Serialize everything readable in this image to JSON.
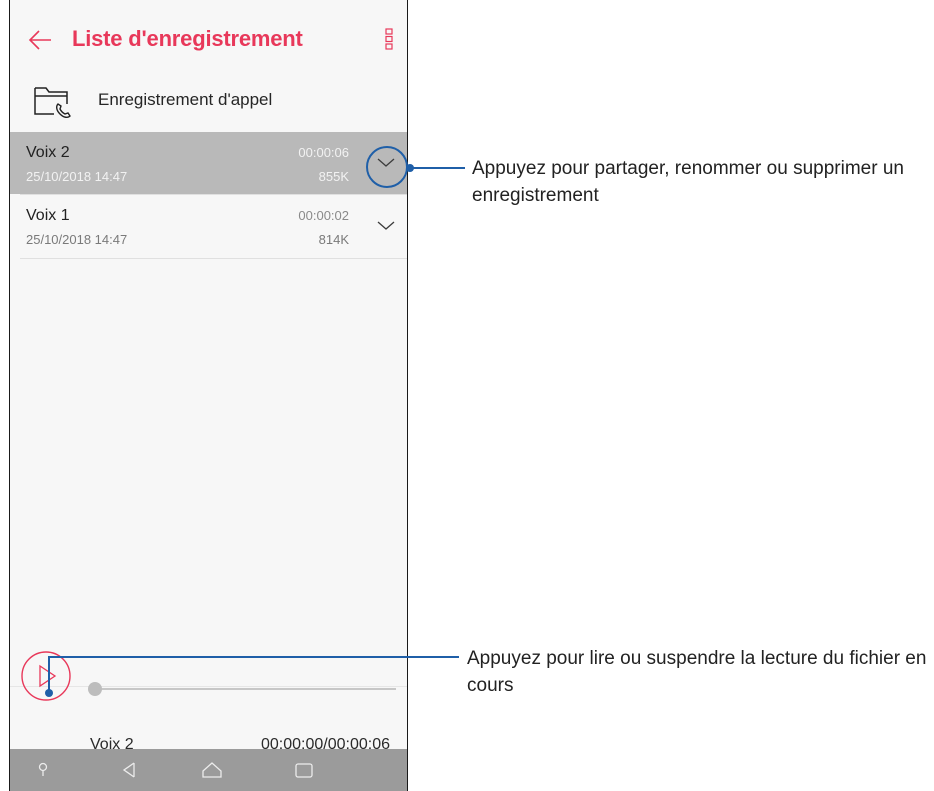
{
  "header": {
    "title": "Liste d'enregistrement",
    "back_icon": "arrow-left-icon",
    "menu_icon": "more-vert-icon"
  },
  "folder": {
    "label": "Enregistrement d'appel",
    "icon": "call-folder-icon"
  },
  "recordings": [
    {
      "name": "Voix 2",
      "date": "25/10/2018 14:47",
      "duration": "00:00:06",
      "size": "855K",
      "selected": true
    },
    {
      "name": "Voix 1",
      "date": "25/10/2018 14:47",
      "duration": "00:00:02",
      "size": "814K",
      "selected": false
    }
  ],
  "player": {
    "track_name": "Voix 2",
    "time": "00:00:00/00:00:06",
    "progress": 0,
    "play_icon": "play-icon"
  },
  "navbar": {
    "icons": [
      "pin-icon",
      "back-triangle-icon",
      "home-icon",
      "recents-icon"
    ]
  },
  "callouts": {
    "share_text": "Appuyez pour partager, renommer ou supprimer un enregistrement",
    "play_text": "Appuyez pour lire ou suspendre la lecture du fichier en cours"
  },
  "colors": {
    "accent": "#e8385a",
    "callout_line": "#1f5fa8",
    "selected_row": "#b9b9b9",
    "navbar": "#9b9b9b"
  }
}
